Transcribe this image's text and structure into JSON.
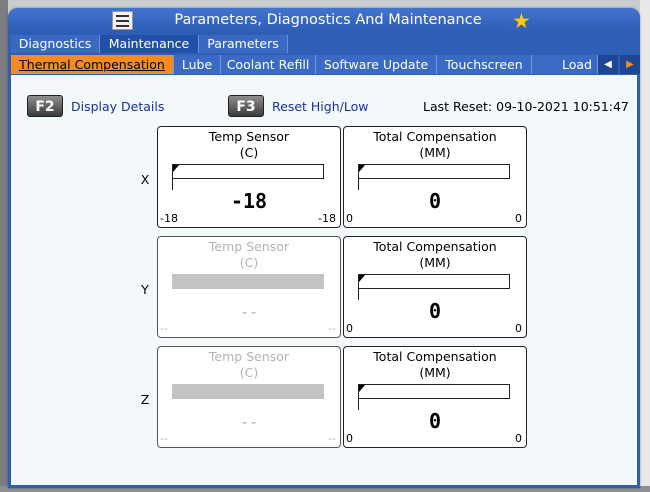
{
  "window": {
    "title": "Parameters, Diagnostics And Maintenance"
  },
  "tabs_primary": [
    {
      "label": "Diagnostics",
      "active": false
    },
    {
      "label": "Maintenance",
      "active": true
    },
    {
      "label": "Parameters",
      "active": false
    }
  ],
  "tabs_secondary": [
    {
      "label": "Thermal Compensation",
      "active": true
    },
    {
      "label": "Lube",
      "active": false
    },
    {
      "label": "Coolant Refill",
      "active": false
    },
    {
      "label": "Software Update",
      "active": false
    },
    {
      "label": "Touchscreen",
      "active": false
    },
    {
      "label": "Load",
      "active": false
    }
  ],
  "toolbar": {
    "f2_key": "F2",
    "f2_label": "Display Details",
    "f3_key": "F3",
    "f3_label": "Reset High/Low",
    "last_reset_label": "Last Reset:",
    "last_reset_value": "09-10-2021 10:51:47"
  },
  "axes": [
    {
      "axis": "X",
      "temp": {
        "title": "Temp Sensor",
        "unit": "(C)",
        "value": "-18",
        "min": "-18",
        "max": "-18",
        "enabled": true
      },
      "comp": {
        "title": "Total Compensation",
        "unit": "(MM)",
        "value": "0",
        "min": "0",
        "max": "0",
        "enabled": true
      }
    },
    {
      "axis": "Y",
      "temp": {
        "title": "Temp Sensor",
        "unit": "(C)",
        "value": "--",
        "min": "--",
        "max": "--",
        "enabled": false
      },
      "comp": {
        "title": "Total Compensation",
        "unit": "(MM)",
        "value": "0",
        "min": "0",
        "max": "0",
        "enabled": true
      }
    },
    {
      "axis": "Z",
      "temp": {
        "title": "Temp Sensor",
        "unit": "(C)",
        "value": "--",
        "min": "--",
        "max": "--",
        "enabled": false
      },
      "comp": {
        "title": "Total Compensation",
        "unit": "(MM)",
        "value": "0",
        "min": "0",
        "max": "0",
        "enabled": true
      }
    }
  ],
  "colors": {
    "titlebar": "#2f5fb5",
    "active_tab": "#f58c1f",
    "favorite_star": "#f5cc1a",
    "link_text": "#1b2fa3"
  },
  "icons": {
    "menu": "hamburger-menu-icon",
    "favorite": "star-icon",
    "scroll_left": "triangle-left-icon",
    "scroll_right": "triangle-right-icon"
  }
}
